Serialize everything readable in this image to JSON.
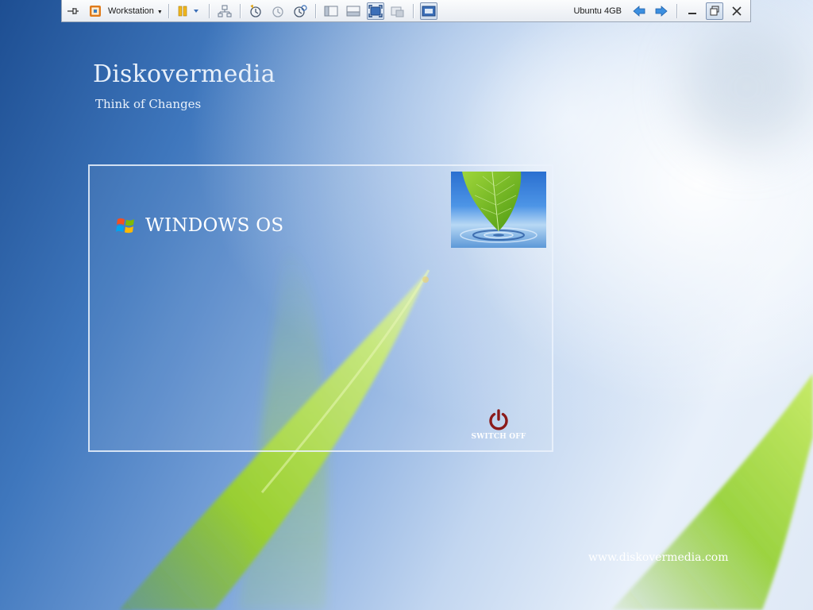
{
  "toolbar": {
    "vm_menu_label": "Workstation",
    "vm_name": "Ubuntu 4GB"
  },
  "brand": {
    "title": "Diskovermedia",
    "subtitle": "Think of Changes"
  },
  "boot_menu": {
    "os_option_label": "WINDOWS OS",
    "switch_off_label": "SWITCH OFF"
  },
  "footer": {
    "website": "www.diskovermedia.com"
  },
  "colors": {
    "power_icon": "#8b1a1a",
    "panel_border": "#ebf2fc",
    "grass_green": "#8cc71e"
  }
}
